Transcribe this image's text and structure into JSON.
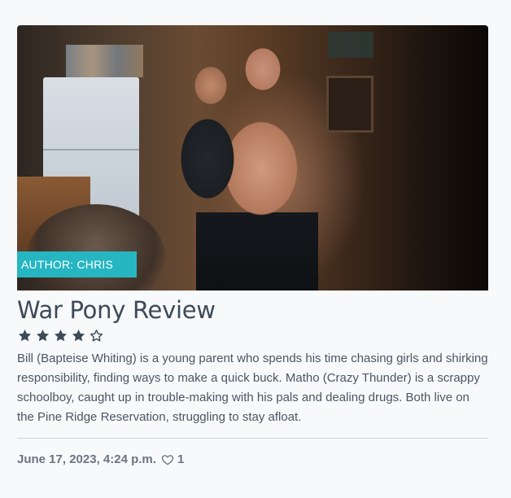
{
  "post": {
    "author_badge": "AUTHOR: CHRIS",
    "title": "War Pony Review",
    "rating": {
      "value": 4,
      "max": 5
    },
    "description": "Bill (Bapteise Whiting) is a young parent who spends his time chasing girls and shirking responsibility, finding ways to make a quick buck. Matho (Crazy Thunder) is a scrappy schoolboy, caught up in trouble-making with his pals and dealing drugs. Both live on the Pine Ridge Reservation, struggling to stay afloat.",
    "date": "June 17, 2023, 4:24 p.m.",
    "likes": "1"
  },
  "icons": {
    "star_filled": "star-filled-icon",
    "star_empty": "star-outline-icon",
    "heart": "heart-outline-icon"
  },
  "colors": {
    "badge_bg": "#26b6c1",
    "title": "#3d4a58",
    "star": "#3d4a58",
    "meta": "#6b7480"
  }
}
